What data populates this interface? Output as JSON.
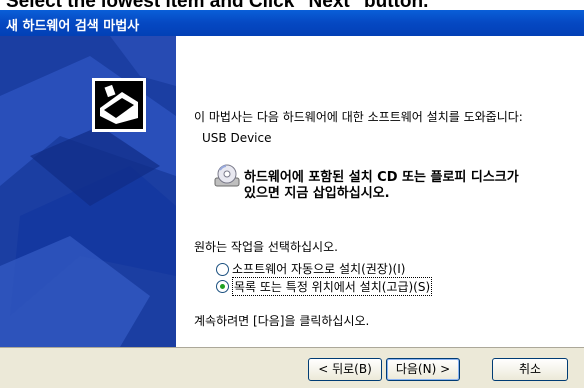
{
  "caption": "Select the lowest item and Click \"Next\" button.",
  "window": {
    "title": "새 하드웨어 검색 마법사"
  },
  "intro_text": "이 마법사는 다음 하드웨어에 대한 소프트웨어 설치를 도와줍니다:",
  "device_name": "USB Device",
  "cd_prompt": {
    "line1": "하드웨어에 포함된 설치 CD 또는 플로피 디스크가",
    "line2": "있으면 지금 삽입하십시오."
  },
  "task_prompt": "원하는 작업을 선택하십시오.",
  "options": [
    {
      "label": "소프트웨어 자동으로 설치(권장)(I)",
      "selected": false
    },
    {
      "label": "목록 또는 특정 위치에서 설치(고급)(S)",
      "selected": true
    }
  ],
  "continue_text": "계속하려면 [다음]을 클릭하십시오.",
  "buttons": {
    "back": "< 뒤로(B)",
    "next": "다음(N) >",
    "cancel": "취소"
  },
  "colors": {
    "titlebar": "#0548c2",
    "sidebar": "#1b3ea2",
    "radio_selected": "#21a121"
  }
}
